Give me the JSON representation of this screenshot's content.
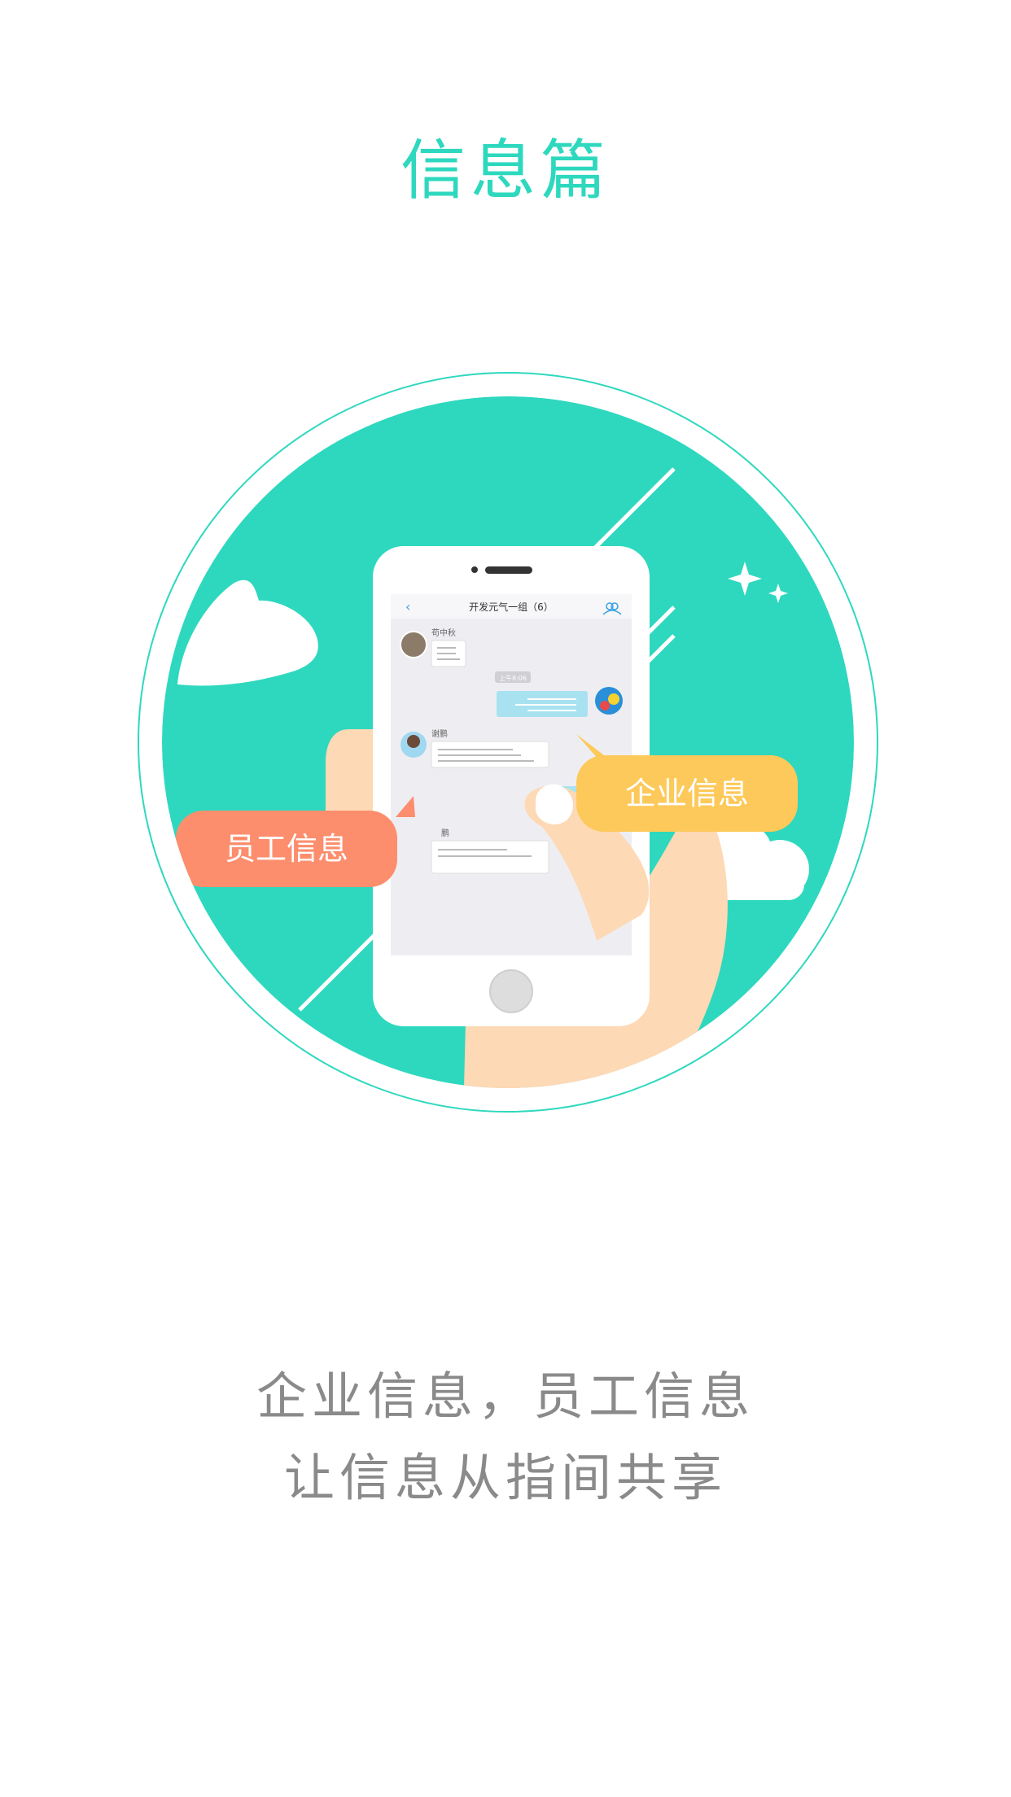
{
  "page": {
    "title": "信息篇",
    "tagline_line1": "企业信息，员工信息",
    "tagline_line2": "让信息从指间共享"
  },
  "illustration": {
    "enterprise_bubble": "企业信息",
    "employee_bubble": "员工信息",
    "phone_screen": {
      "chat_title": "开发元气一组（6）",
      "sender1_name": "苟中秋",
      "timestamp": "上午8:06",
      "sender2_name": "谢鹏",
      "sender3_name_partial": "鹏"
    }
  },
  "colors": {
    "primary_teal": "#2ed8be",
    "enterprise_bubble": "#fdc95a",
    "employee_bubble": "#fc8e6e",
    "skin": "#fdd9b5",
    "tagline_gray": "#8a8a8a"
  }
}
